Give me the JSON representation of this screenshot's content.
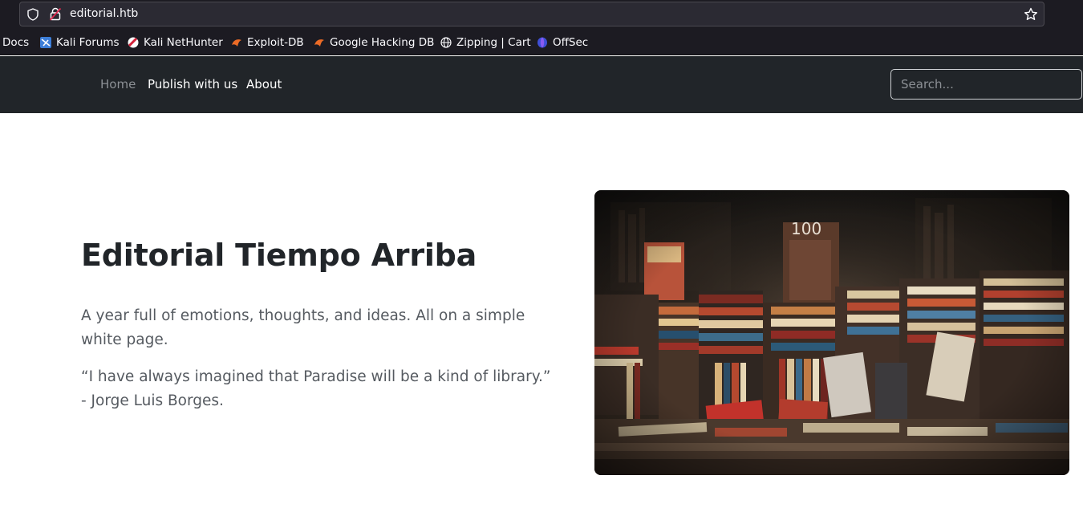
{
  "browser": {
    "url": "editorial.htb",
    "bookmarks": [
      {
        "label": "i Docs",
        "icon": "docs-icon"
      },
      {
        "label": "Kali Forums",
        "icon": "kali-forums-icon"
      },
      {
        "label": "Kali NetHunter",
        "icon": "kali-nethunter-icon"
      },
      {
        "label": "Exploit-DB",
        "icon": "exploit-db-icon"
      },
      {
        "label": "Google Hacking DB",
        "icon": "google-hacking-db-icon"
      },
      {
        "label": "Zipping | Cart",
        "icon": "globe-icon"
      },
      {
        "label": "OffSec",
        "icon": "offsec-icon"
      }
    ]
  },
  "navbar": {
    "links": [
      "Home",
      "Publish with us",
      "About"
    ],
    "search_placeholder": "Search..."
  },
  "hero": {
    "title": "Editorial Tiempo Arriba",
    "lead": "A year full of emotions, thoughts, and ideas. All on a simple white page.",
    "quote": "“I have always imagined that Paradise will be a kind of library.” - Jorge Luis Borges."
  },
  "colors": {
    "navbar_bg": "#212529",
    "chrome_bg": "#1c1b22",
    "title_text": "#212529",
    "body_text": "#555a60"
  }
}
